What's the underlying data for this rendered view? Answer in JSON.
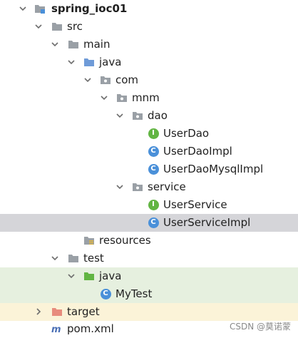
{
  "project_tree": {
    "project_name": "spring_ioc01",
    "src": "src",
    "main": "main",
    "main_java": "java",
    "com": "com",
    "mnm": "mnm",
    "dao": "dao",
    "user_dao": "UserDao",
    "user_dao_impl": "UserDaoImpl",
    "user_dao_mysql_impl": "UserDaoMysqlImpl",
    "service": "service",
    "user_service": "UserService",
    "user_service_impl": "UserServiceImpl",
    "resources": "resources",
    "test": "test",
    "test_java": "java",
    "my_test": "MyTest",
    "target": "target",
    "pom": "pom.xml"
  },
  "badges": {
    "interface": "I",
    "class": "C"
  },
  "watermark": "CSDN @莫诺蒙",
  "colors": {
    "selected_row": "#d5d5d9",
    "test_row": "#e6f0df",
    "excluded_row": "#fbf3d8",
    "interface_badge": "#62b543",
    "class_badge": "#4a90d9",
    "excluded_text": "#c75450"
  }
}
